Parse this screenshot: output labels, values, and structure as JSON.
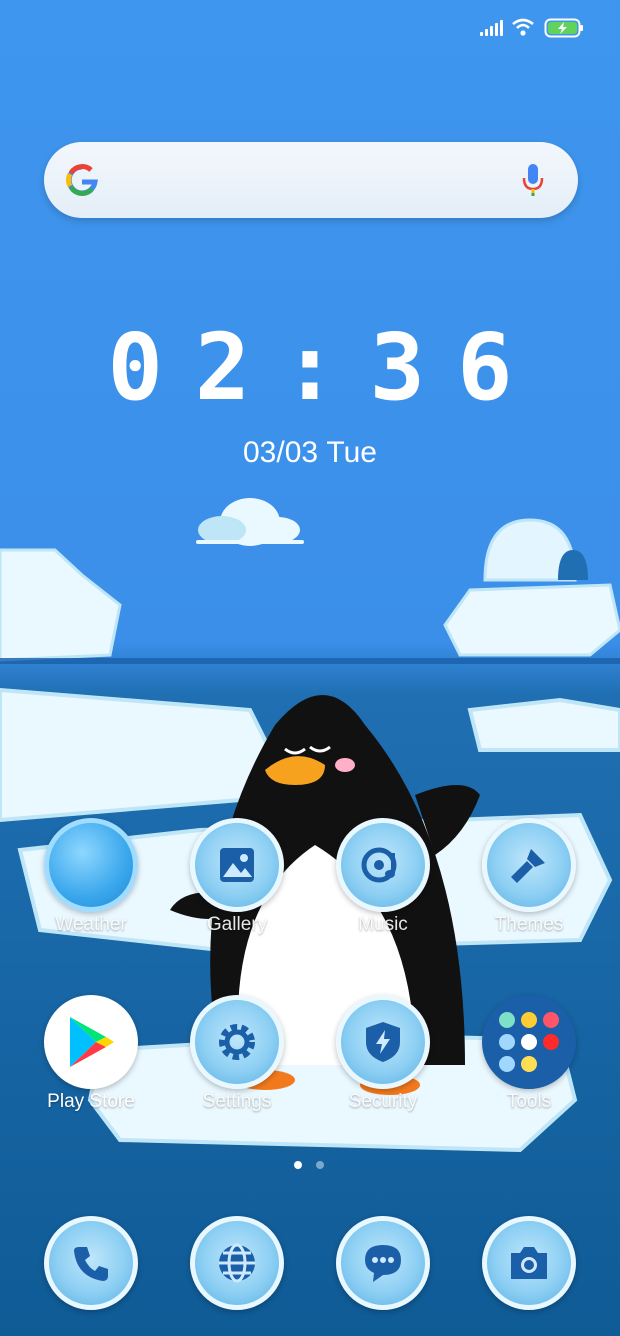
{
  "status_bar": {
    "signal_icon": "signal-icon",
    "wifi_icon": "wifi-icon",
    "battery_icon": "battery-charging-icon"
  },
  "search_bar": {
    "logo": "google-logo",
    "mic_icon": "mic-icon"
  },
  "clock": {
    "time": "02:36",
    "date_prefix": "03/03",
    "day": "Tue"
  },
  "apps": [
    {
      "label": "Weather",
      "icon": "weather-icon"
    },
    {
      "label": "Gallery",
      "icon": "gallery-icon"
    },
    {
      "label": "Music",
      "icon": "music-icon"
    },
    {
      "label": "Themes",
      "icon": "themes-icon"
    },
    {
      "label": "Play Store",
      "icon": "play-store-icon"
    },
    {
      "label": "Settings",
      "icon": "settings-icon"
    },
    {
      "label": "Security",
      "icon": "security-icon"
    },
    {
      "label": "Tools",
      "icon": "tools-folder-icon"
    }
  ],
  "page_indicator": {
    "current": 1,
    "total": 2
  },
  "dock": [
    {
      "name": "Phone",
      "icon": "phone-icon"
    },
    {
      "name": "Browser",
      "icon": "browser-icon"
    },
    {
      "name": "Messages",
      "icon": "messages-icon"
    },
    {
      "name": "Camera",
      "icon": "camera-icon"
    }
  ],
  "colors": {
    "sky": "#3f96ee",
    "sea": "#0f5b96",
    "ice": "#eaf8ff",
    "accent": "#1a5fa8"
  }
}
